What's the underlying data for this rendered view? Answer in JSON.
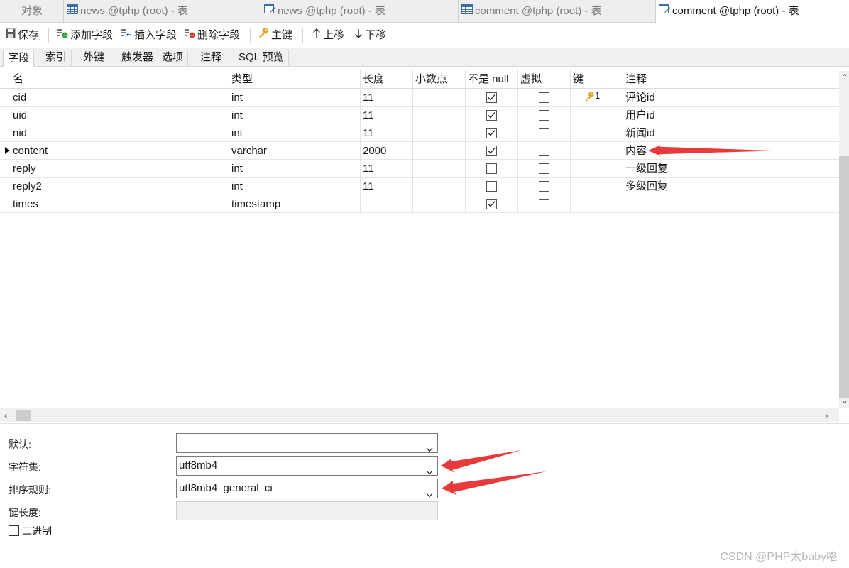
{
  "doc_tabs": [
    {
      "label": "对象",
      "icon": "none"
    },
    {
      "label": "news @tphp (root) - 表",
      "icon": "table-icon"
    },
    {
      "label": "news @tphp (root) - 表",
      "icon": "table-design-icon"
    },
    {
      "label": "comment @tphp (root) - 表",
      "icon": "table-icon"
    },
    {
      "label": "comment @tphp (root) - 表",
      "icon": "table-design-icon"
    }
  ],
  "toolbar": {
    "save": "保存",
    "add_field": "添加字段",
    "insert_field": "插入字段",
    "delete_field": "删除字段",
    "primary_key": "主键",
    "move_up": "上移",
    "move_down": "下移"
  },
  "sub_tabs": [
    "字段",
    "索引",
    "外键",
    "触发器",
    "选项",
    "注释",
    "SQL 预览"
  ],
  "grid": {
    "columns": [
      "名",
      "类型",
      "长度",
      "小数点",
      "不是 null",
      "虚拟",
      "键",
      "注释"
    ],
    "rows": [
      {
        "name": "cid",
        "type": "int",
        "length": "11",
        "decimals": "",
        "not_null": true,
        "virtual": false,
        "key": "1",
        "comment": "评论id"
      },
      {
        "name": "uid",
        "type": "int",
        "length": "11",
        "decimals": "",
        "not_null": true,
        "virtual": false,
        "key": "",
        "comment": "用户id"
      },
      {
        "name": "nid",
        "type": "int",
        "length": "11",
        "decimals": "",
        "not_null": true,
        "virtual": false,
        "key": "",
        "comment": "新闻id"
      },
      {
        "name": "content",
        "type": "varchar",
        "length": "2000",
        "decimals": "",
        "not_null": true,
        "virtual": false,
        "key": "",
        "comment": "内容",
        "current": true
      },
      {
        "name": "reply",
        "type": "int",
        "length": "11",
        "decimals": "",
        "not_null": false,
        "virtual": false,
        "key": "",
        "comment": "一级回复"
      },
      {
        "name": "reply2",
        "type": "int",
        "length": "11",
        "decimals": "",
        "not_null": false,
        "virtual": false,
        "key": "",
        "comment": "多级回复"
      },
      {
        "name": "times",
        "type": "timestamp",
        "length": "",
        "decimals": "",
        "not_null": true,
        "virtual": false,
        "key": "",
        "comment": ""
      }
    ]
  },
  "properties": {
    "default_label": "默认:",
    "default_value": "",
    "charset_label": "字符集:",
    "charset_value": "utf8mb4",
    "collation_label": "排序规则:",
    "collation_value": "utf8mb4_general_ci",
    "key_length_label": "键长度:",
    "key_length_value": "",
    "binary_label": "二进制",
    "binary_checked": false
  },
  "colors": {
    "annotation_arrow": "#e83a3a",
    "key_icon": "#e0a020"
  },
  "watermark": "CSDN @PHP太baby咯"
}
